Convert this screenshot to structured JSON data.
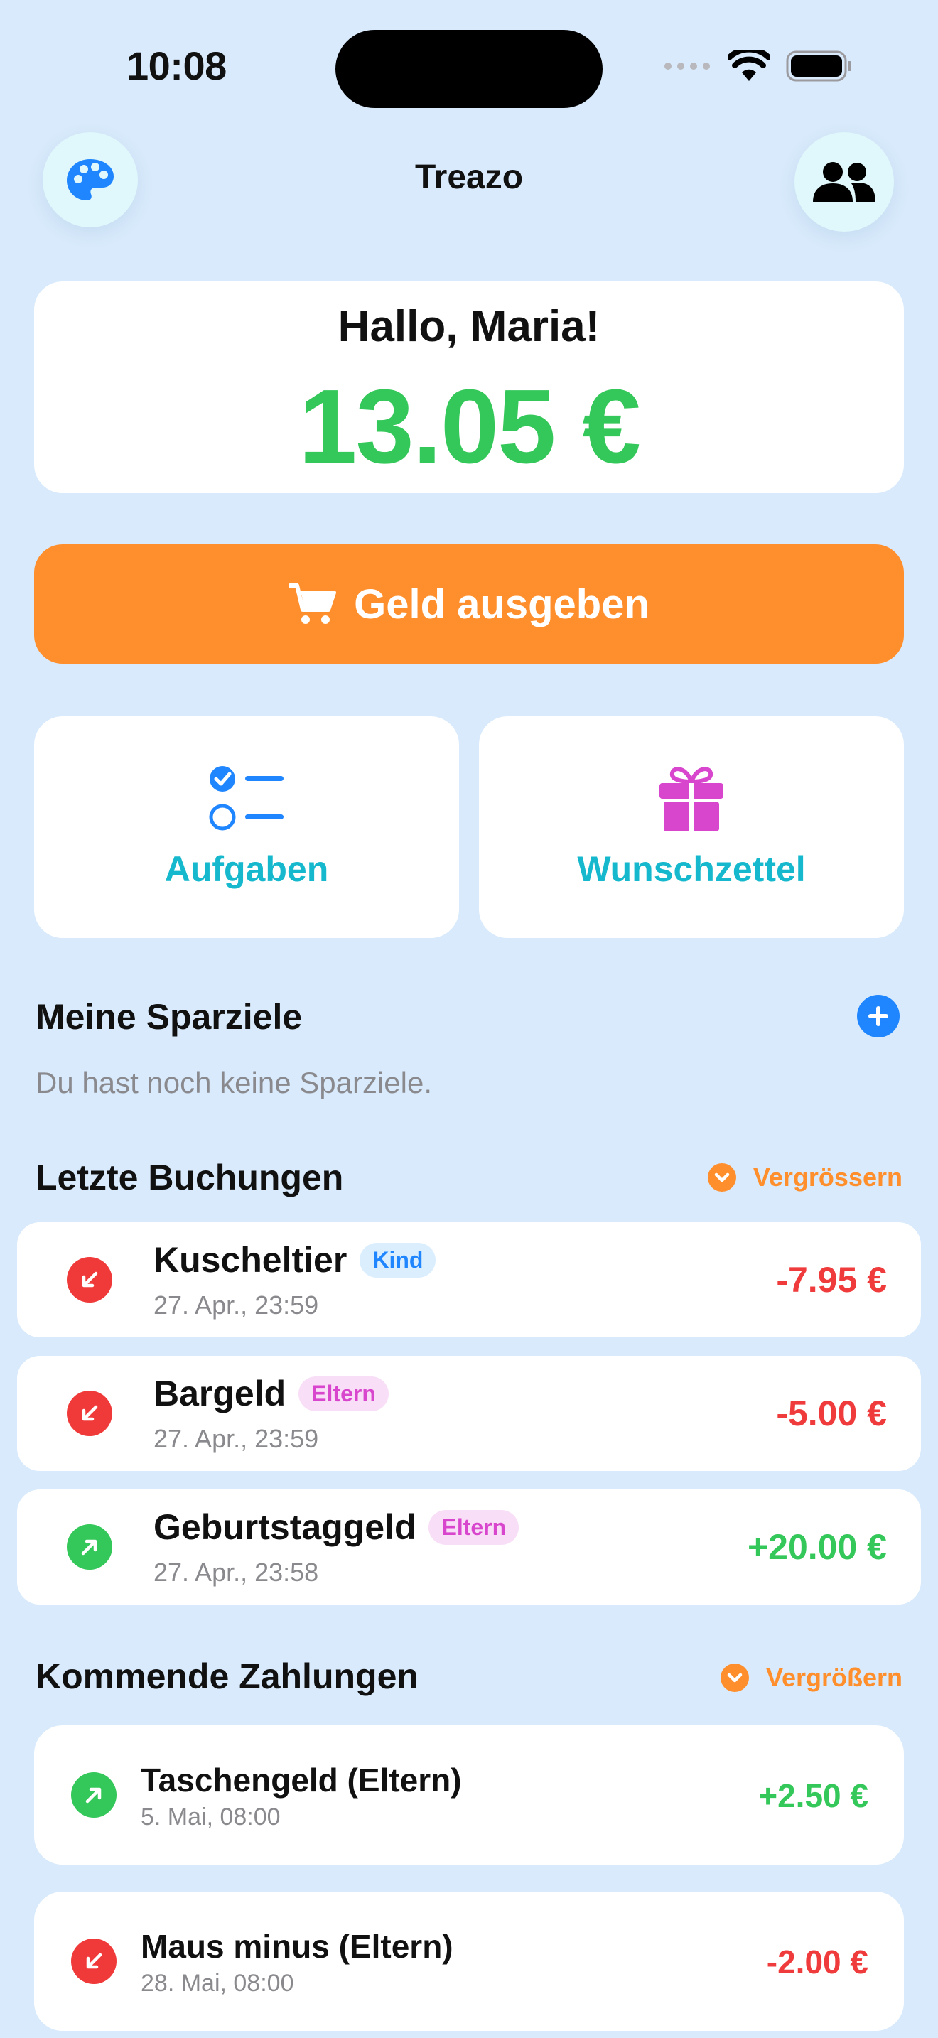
{
  "status": {
    "time": "10:08"
  },
  "header": {
    "title": "Treazo",
    "left_icon": "palette-icon",
    "right_icon": "people-icon"
  },
  "greeting": {
    "text": "Hallo, Maria!",
    "balance": "13.05 €"
  },
  "spend_button": {
    "label": "Geld ausgeben",
    "icon": "cart-icon"
  },
  "tiles": [
    {
      "label": "Aufgaben",
      "icon": "checklist-icon"
    },
    {
      "label": "Wunschzettel",
      "icon": "gift-icon"
    }
  ],
  "goals": {
    "title": "Meine Sparziele",
    "empty": "Du hast noch keine Sparziele."
  },
  "transactions": {
    "title": "Letzte Buchungen",
    "expand_label": "Vergrössern",
    "items": [
      {
        "name": "Kuscheltier",
        "badge": "Kind",
        "date": "27. Apr., 23:59",
        "amount": "-7.95 €"
      },
      {
        "name": "Bargeld",
        "badge": "Eltern",
        "date": "27. Apr., 23:59",
        "amount": "-5.00 €"
      },
      {
        "name": "Geburtstaggeld",
        "badge": "Eltern",
        "date": "27. Apr., 23:58",
        "amount": "+20.00 €"
      }
    ]
  },
  "upcoming": {
    "title": "Kommende Zahlungen",
    "expand_label": "Vergrößern",
    "items": [
      {
        "name": "Taschengeld (Eltern)",
        "date": "5. Mai, 08:00",
        "amount": "+2.50 €"
      },
      {
        "name": "Maus minus (Eltern)",
        "date": "28. Mai, 08:00",
        "amount": "-2.00 €"
      }
    ]
  },
  "colors": {
    "accent": "#ff8f2d",
    "positive": "#34c759",
    "negative": "#ef3b3b",
    "background": "#d8eafb"
  }
}
